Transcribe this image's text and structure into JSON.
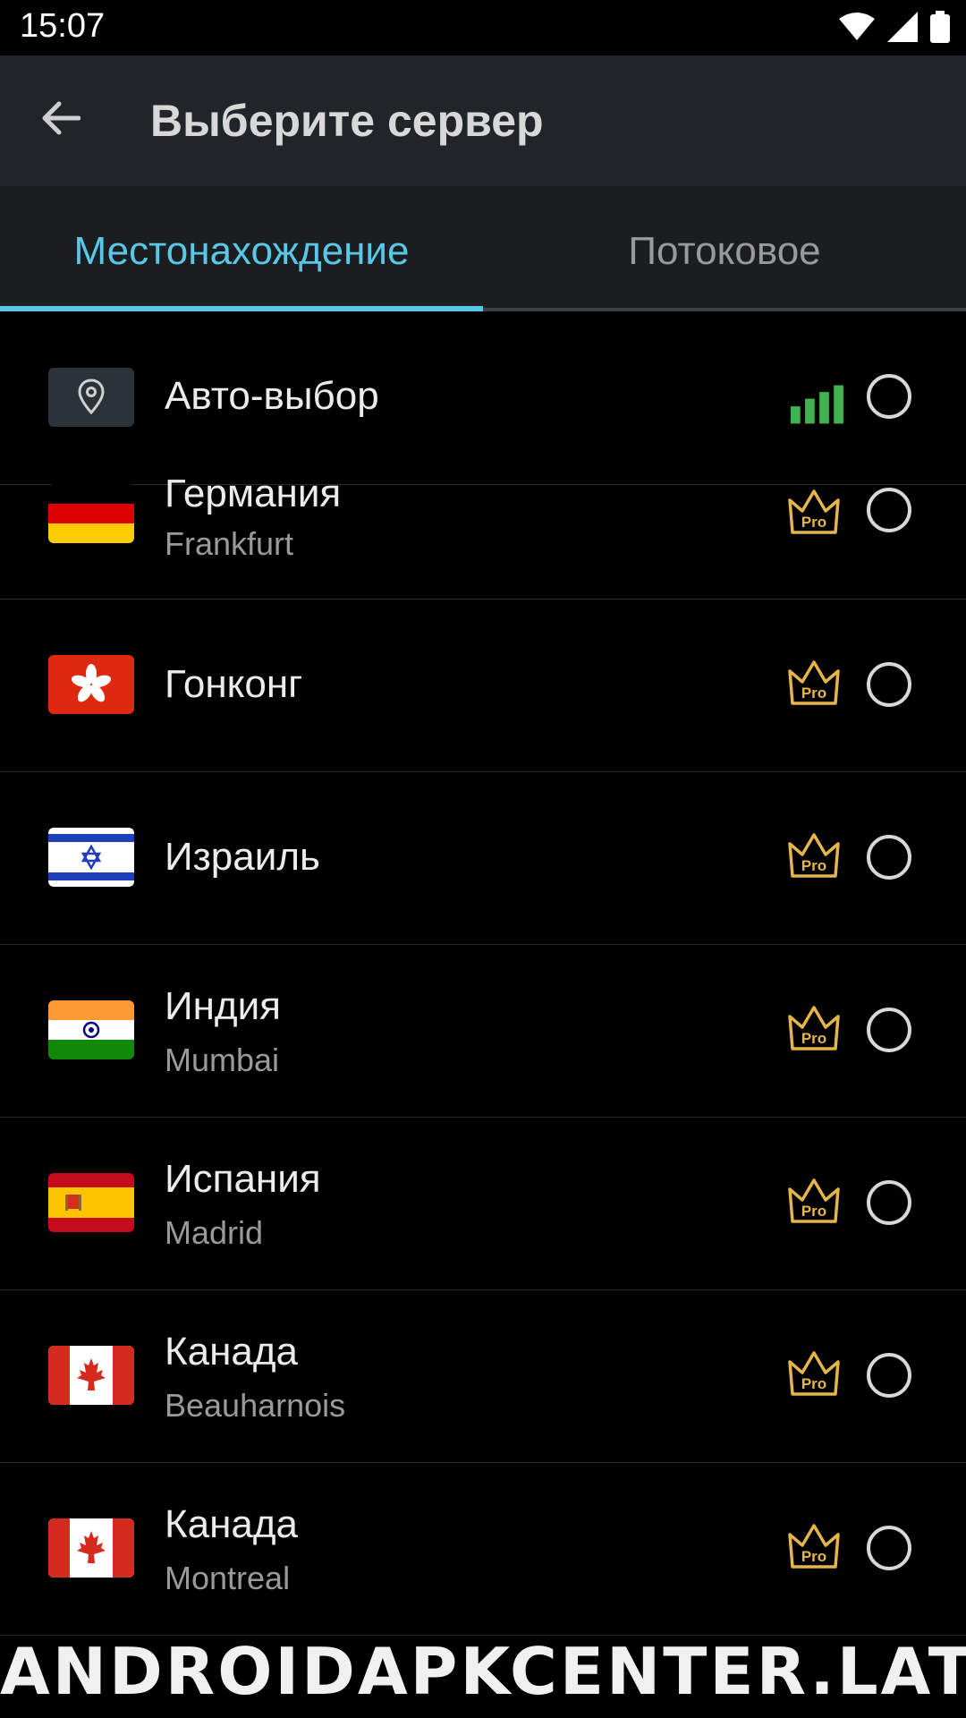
{
  "status_bar": {
    "time": "15:07"
  },
  "app_bar": {
    "title": "Выберите сервер"
  },
  "tabs": [
    {
      "label": "Местонахождение",
      "selected": true
    },
    {
      "label": "Потоковое",
      "selected": false
    }
  ],
  "auto": {
    "label": "Авто-выбор"
  },
  "servers": [
    {
      "country": "Германия",
      "city": "Frankfurt",
      "flag": "germany-flag",
      "pro": "Pro"
    },
    {
      "country": "Гонконг",
      "city": "",
      "flag": "hong-kong-flag",
      "pro": "Pro"
    },
    {
      "country": "Израиль",
      "city": "",
      "flag": "israel-flag",
      "pro": "Pro"
    },
    {
      "country": "Индия",
      "city": "Mumbai",
      "flag": "india-flag",
      "pro": "Pro"
    },
    {
      "country": "Испания",
      "city": "Madrid",
      "flag": "spain-flag",
      "pro": "Pro"
    },
    {
      "country": "Канада",
      "city": "Beauharnois",
      "flag": "canada-flag",
      "pro": "Pro"
    },
    {
      "country": "Канада",
      "city": "Montreal",
      "flag": "canada-flag",
      "pro": "Pro"
    }
  ],
  "colors": {
    "accent": "#59c8e8",
    "pro_gold": "#e6b54a",
    "signal_green": "#3fb34f"
  },
  "watermark": "ANDROIDAPKCENTER.LAT"
}
